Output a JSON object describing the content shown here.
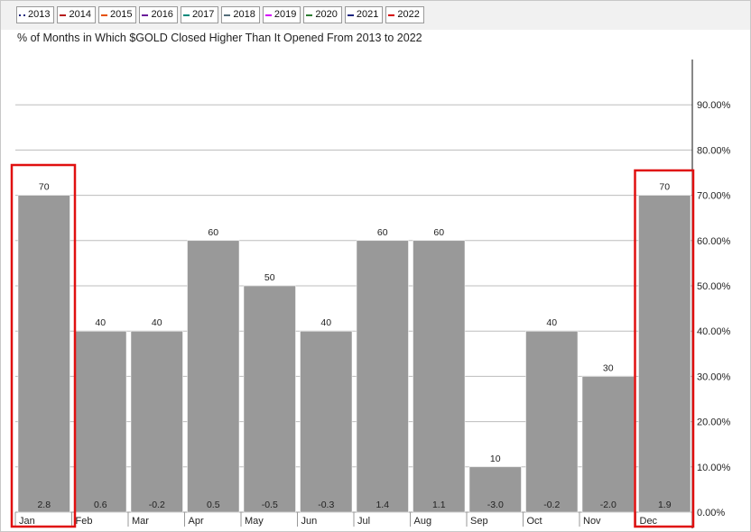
{
  "legend": [
    {
      "label": "2013",
      "color": "#1a237e",
      "style": "dotted"
    },
    {
      "label": "2014",
      "color": "#b71c1c",
      "style": "solid"
    },
    {
      "label": "2015",
      "color": "#e65100",
      "style": "solid"
    },
    {
      "label": "2016",
      "color": "#6a1b9a",
      "style": "solid"
    },
    {
      "label": "2017",
      "color": "#00897b",
      "style": "solid"
    },
    {
      "label": "2018",
      "color": "#546e7a",
      "style": "solid"
    },
    {
      "label": "2019",
      "color": "#d500f9",
      "style": "solid"
    },
    {
      "label": "2020",
      "color": "#2e7d32",
      "style": "solid"
    },
    {
      "label": "2021",
      "color": "#1a237e",
      "style": "solid"
    },
    {
      "label": "2022",
      "color": "#d50000",
      "style": "solid"
    }
  ],
  "colors": {
    "bar": "#999999",
    "bar_border": "#ffffff",
    "grid": "#bdbdbd",
    "highlight": "#e01010"
  },
  "chart_data": {
    "type": "bar",
    "title": "% of Months in Which $GOLD Closed Higher Than It Opened From 2013 to 2022",
    "categories": [
      "Jan",
      "Feb",
      "Mar",
      "Apr",
      "May",
      "Jun",
      "Jul",
      "Aug",
      "Sep",
      "Oct",
      "Nov",
      "Dec"
    ],
    "values": [
      70,
      40,
      40,
      60,
      50,
      40,
      60,
      60,
      10,
      40,
      30,
      70
    ],
    "bottom_labels": [
      "2.8",
      "0.6",
      "-0.2",
      "0.5",
      "-0.5",
      "-0.3",
      "1.4",
      "1.1",
      "-3.0",
      "-0.2",
      "-2.0",
      "1.9"
    ],
    "yticks": [
      "0.00%",
      "10.00%",
      "20.00%",
      "30.00%",
      "40.00%",
      "50.00%",
      "60.00%",
      "70.00%",
      "80.00%",
      "90.00%"
    ],
    "ylim": [
      0,
      100
    ],
    "y_axis_side": "right",
    "grid": true,
    "highlighted_categories": [
      "Jan",
      "Dec"
    ]
  }
}
